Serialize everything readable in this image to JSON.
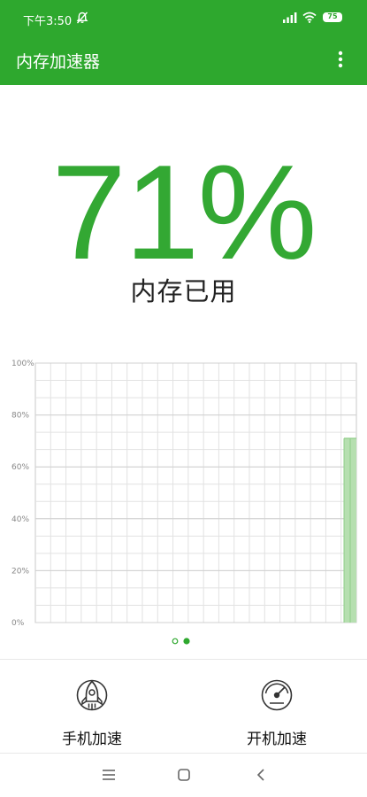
{
  "status_bar": {
    "time": "下午3:50",
    "battery": "75",
    "icons": [
      "mute-icon",
      "signal-icon",
      "wifi-icon",
      "battery-icon"
    ]
  },
  "app_bar": {
    "title": "内存加速器",
    "icons": [
      "more-vertical-icon"
    ]
  },
  "memory": {
    "percent_text": "71%",
    "label": "内存已用"
  },
  "chart_data": {
    "type": "area",
    "y_tick_labels": [
      "100%",
      "80%",
      "60%",
      "40%",
      "20%",
      "0%"
    ],
    "ylim": [
      0,
      100
    ],
    "grid": true,
    "series": [
      {
        "values": [
          71,
          71
        ]
      }
    ]
  },
  "pager": {
    "page_count": 2,
    "active_index": 1
  },
  "actions": [
    {
      "label": "手机加速",
      "icon": "rocket-icon"
    },
    {
      "label": "开机加速",
      "icon": "speedometer-icon"
    }
  ],
  "nav_bar": {
    "icons": [
      "menu-icon",
      "home-icon",
      "back-icon"
    ]
  },
  "colors": {
    "primary": "#2ea82e",
    "percent": "#33a833",
    "fill": "#b6dfb0",
    "fill_edge": "#8fcd88"
  }
}
